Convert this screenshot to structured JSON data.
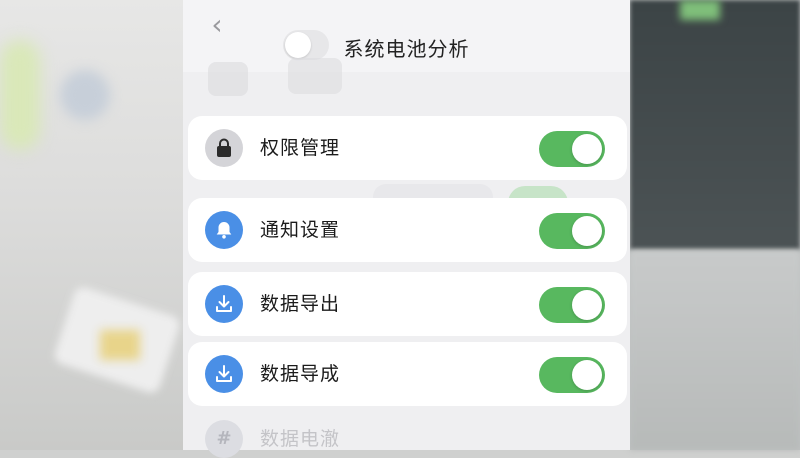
{
  "header": {
    "back_glyph": "‹",
    "title": "系统电池分析"
  },
  "settings": [
    {
      "label": "权限管理",
      "icon": "lock-icon",
      "icon_bg": "#d4d4d8",
      "enabled": true
    },
    {
      "label": "通知设置",
      "icon": "bell-icon",
      "icon_bg": "#4a8fe6",
      "enabled": true
    },
    {
      "label": "数据导出",
      "icon": "download-icon",
      "icon_bg": "#4a8fe6",
      "enabled": true
    },
    {
      "label": "数据导成",
      "icon": "download-icon",
      "icon_bg": "#4a8fe6",
      "enabled": true
    }
  ],
  "faded_item": {
    "label": "数据电澈",
    "icon_glyph": "#"
  },
  "colors": {
    "toggle_on": "#58b85f",
    "accent_blue": "#4a8fe6"
  }
}
